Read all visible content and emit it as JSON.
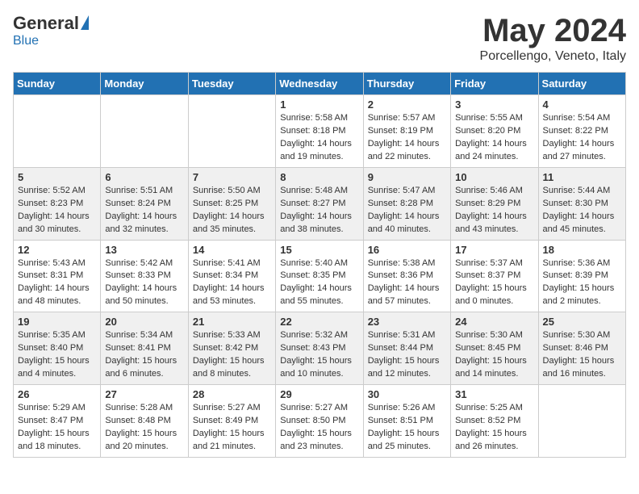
{
  "header": {
    "logo_general": "General",
    "logo_blue": "Blue",
    "month": "May 2024",
    "location": "Porcellengo, Veneto, Italy"
  },
  "days_of_week": [
    "Sunday",
    "Monday",
    "Tuesday",
    "Wednesday",
    "Thursday",
    "Friday",
    "Saturday"
  ],
  "weeks": [
    [
      {
        "day": "",
        "info": ""
      },
      {
        "day": "",
        "info": ""
      },
      {
        "day": "",
        "info": ""
      },
      {
        "day": "1",
        "info": "Sunrise: 5:58 AM\nSunset: 8:18 PM\nDaylight: 14 hours\nand 19 minutes."
      },
      {
        "day": "2",
        "info": "Sunrise: 5:57 AM\nSunset: 8:19 PM\nDaylight: 14 hours\nand 22 minutes."
      },
      {
        "day": "3",
        "info": "Sunrise: 5:55 AM\nSunset: 8:20 PM\nDaylight: 14 hours\nand 24 minutes."
      },
      {
        "day": "4",
        "info": "Sunrise: 5:54 AM\nSunset: 8:22 PM\nDaylight: 14 hours\nand 27 minutes."
      }
    ],
    [
      {
        "day": "5",
        "info": "Sunrise: 5:52 AM\nSunset: 8:23 PM\nDaylight: 14 hours\nand 30 minutes."
      },
      {
        "day": "6",
        "info": "Sunrise: 5:51 AM\nSunset: 8:24 PM\nDaylight: 14 hours\nand 32 minutes."
      },
      {
        "day": "7",
        "info": "Sunrise: 5:50 AM\nSunset: 8:25 PM\nDaylight: 14 hours\nand 35 minutes."
      },
      {
        "day": "8",
        "info": "Sunrise: 5:48 AM\nSunset: 8:27 PM\nDaylight: 14 hours\nand 38 minutes."
      },
      {
        "day": "9",
        "info": "Sunrise: 5:47 AM\nSunset: 8:28 PM\nDaylight: 14 hours\nand 40 minutes."
      },
      {
        "day": "10",
        "info": "Sunrise: 5:46 AM\nSunset: 8:29 PM\nDaylight: 14 hours\nand 43 minutes."
      },
      {
        "day": "11",
        "info": "Sunrise: 5:44 AM\nSunset: 8:30 PM\nDaylight: 14 hours\nand 45 minutes."
      }
    ],
    [
      {
        "day": "12",
        "info": "Sunrise: 5:43 AM\nSunset: 8:31 PM\nDaylight: 14 hours\nand 48 minutes."
      },
      {
        "day": "13",
        "info": "Sunrise: 5:42 AM\nSunset: 8:33 PM\nDaylight: 14 hours\nand 50 minutes."
      },
      {
        "day": "14",
        "info": "Sunrise: 5:41 AM\nSunset: 8:34 PM\nDaylight: 14 hours\nand 53 minutes."
      },
      {
        "day": "15",
        "info": "Sunrise: 5:40 AM\nSunset: 8:35 PM\nDaylight: 14 hours\nand 55 minutes."
      },
      {
        "day": "16",
        "info": "Sunrise: 5:38 AM\nSunset: 8:36 PM\nDaylight: 14 hours\nand 57 minutes."
      },
      {
        "day": "17",
        "info": "Sunrise: 5:37 AM\nSunset: 8:37 PM\nDaylight: 15 hours\nand 0 minutes."
      },
      {
        "day": "18",
        "info": "Sunrise: 5:36 AM\nSunset: 8:39 PM\nDaylight: 15 hours\nand 2 minutes."
      }
    ],
    [
      {
        "day": "19",
        "info": "Sunrise: 5:35 AM\nSunset: 8:40 PM\nDaylight: 15 hours\nand 4 minutes."
      },
      {
        "day": "20",
        "info": "Sunrise: 5:34 AM\nSunset: 8:41 PM\nDaylight: 15 hours\nand 6 minutes."
      },
      {
        "day": "21",
        "info": "Sunrise: 5:33 AM\nSunset: 8:42 PM\nDaylight: 15 hours\nand 8 minutes."
      },
      {
        "day": "22",
        "info": "Sunrise: 5:32 AM\nSunset: 8:43 PM\nDaylight: 15 hours\nand 10 minutes."
      },
      {
        "day": "23",
        "info": "Sunrise: 5:31 AM\nSunset: 8:44 PM\nDaylight: 15 hours\nand 12 minutes."
      },
      {
        "day": "24",
        "info": "Sunrise: 5:30 AM\nSunset: 8:45 PM\nDaylight: 15 hours\nand 14 minutes."
      },
      {
        "day": "25",
        "info": "Sunrise: 5:30 AM\nSunset: 8:46 PM\nDaylight: 15 hours\nand 16 minutes."
      }
    ],
    [
      {
        "day": "26",
        "info": "Sunrise: 5:29 AM\nSunset: 8:47 PM\nDaylight: 15 hours\nand 18 minutes."
      },
      {
        "day": "27",
        "info": "Sunrise: 5:28 AM\nSunset: 8:48 PM\nDaylight: 15 hours\nand 20 minutes."
      },
      {
        "day": "28",
        "info": "Sunrise: 5:27 AM\nSunset: 8:49 PM\nDaylight: 15 hours\nand 21 minutes."
      },
      {
        "day": "29",
        "info": "Sunrise: 5:27 AM\nSunset: 8:50 PM\nDaylight: 15 hours\nand 23 minutes."
      },
      {
        "day": "30",
        "info": "Sunrise: 5:26 AM\nSunset: 8:51 PM\nDaylight: 15 hours\nand 25 minutes."
      },
      {
        "day": "31",
        "info": "Sunrise: 5:25 AM\nSunset: 8:52 PM\nDaylight: 15 hours\nand 26 minutes."
      },
      {
        "day": "",
        "info": ""
      }
    ]
  ]
}
